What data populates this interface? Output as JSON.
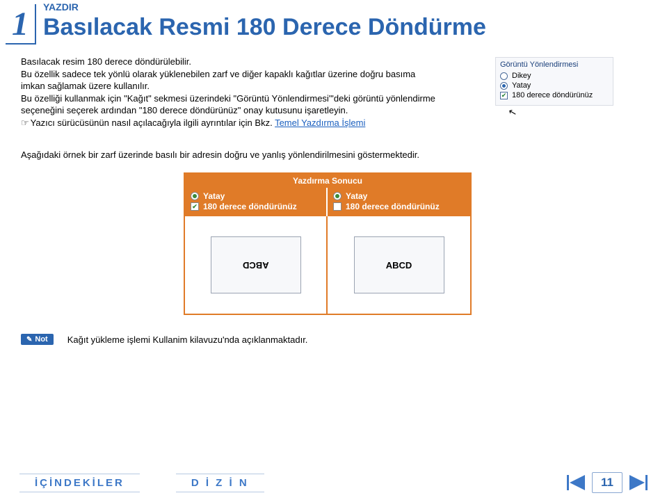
{
  "section_number": "1",
  "category": "YAZDIR",
  "title": "Basılacak Resmi 180 Derece Döndürme",
  "body": {
    "p1": "Basılacak resim 180 derece döndürülebilir.",
    "p2": "Bu özellik sadece tek yönlü olarak yüklenebilen zarf ve diğer kapaklı kağıtlar üzerine doğru basıma imkan sağlamak üzere kullanılır.",
    "p3": "Bu özelliği kullanmak için \"Kağıt\" sekmesi üzerindeki \"Görüntü Yönlendirmesi\"'deki görüntü yönlendirme seçeneğini seçerek ardından \"180 derece döndürünüz\" onay kutusunu işaretleyin.",
    "p4_prefix": "Yazıcı sürücüsünün nasıl açılacağıyla ilgili ayrıntılar için Bkz. ",
    "p4_link": "Temel Yazdırma İşlemi"
  },
  "settings_panel": {
    "title": "Görüntü Yönlendirmesi",
    "options": [
      {
        "label": "Dikey",
        "type": "radio",
        "selected": false
      },
      {
        "label": "Yatay",
        "type": "radio",
        "selected": true
      },
      {
        "label": "180 derece döndürünüz",
        "type": "check",
        "selected": true
      }
    ]
  },
  "example": {
    "intro": "Aşağıdaki örnek bir zarf üzerinde basılı bir adresin doğru ve yanlış yönlendirilmesini göstermektedir.",
    "header": "Yazdırma Sonucu",
    "columns": [
      {
        "radio_label": "Yatay",
        "check_label": "180 derece döndürünüz",
        "check_selected": true,
        "envelope_text": "ABCD",
        "flipped": true
      },
      {
        "radio_label": "Yatay",
        "check_label": "180 derece döndürünüz",
        "check_selected": false,
        "envelope_text": "ABCD",
        "flipped": false
      }
    ]
  },
  "note": {
    "badge": "Not",
    "text": "Kağıt yükleme işlemi Kullanim kilavuzu'nda açıklanmaktadır."
  },
  "footer": {
    "toc": "İÇİNDEKİLER",
    "index": "D İ Z İ N",
    "page": "11"
  }
}
